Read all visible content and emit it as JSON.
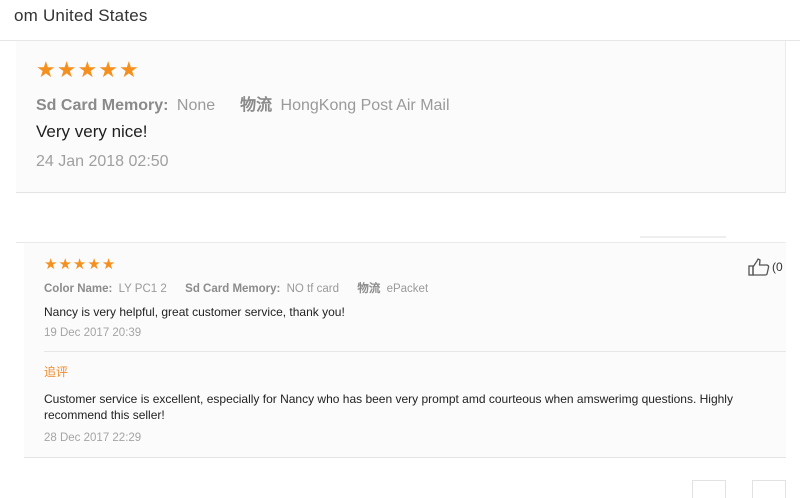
{
  "header": {
    "partial_title": "om United States"
  },
  "review_main": {
    "rating": 5,
    "meta": {
      "sd_card_label": "Sd Card Memory:",
      "sd_card_value": "None",
      "shipping_label": "物流",
      "shipping_value": "HongKong Post Air Mail"
    },
    "feedback": "Very very nice!",
    "date": "24 Jan 2018 02:50"
  },
  "review_second": {
    "rating": 5,
    "meta": {
      "color_label": "Color Name:",
      "color_value": "LY PC1 2",
      "sd_card_label": "Sd Card Memory:",
      "sd_card_value": "NO tf card",
      "shipping_label": "物流",
      "shipping_value": "ePacket"
    },
    "feedback": "Nancy is very helpful, great customer service, thank you!",
    "date": "19 Dec 2017 20:39",
    "additional": {
      "label": "追评",
      "text": "Customer service is excellent, especially for Nancy who has been very prompt amd courteous when amswerimg questions. Highly recommend this seller!",
      "date": "28 Dec 2017 22:29"
    },
    "helpful": {
      "icon": "thumbs-up-icon",
      "count_text": "(0"
    }
  },
  "colors": {
    "star": "#f5901e",
    "additional_label": "#f08c2b"
  }
}
